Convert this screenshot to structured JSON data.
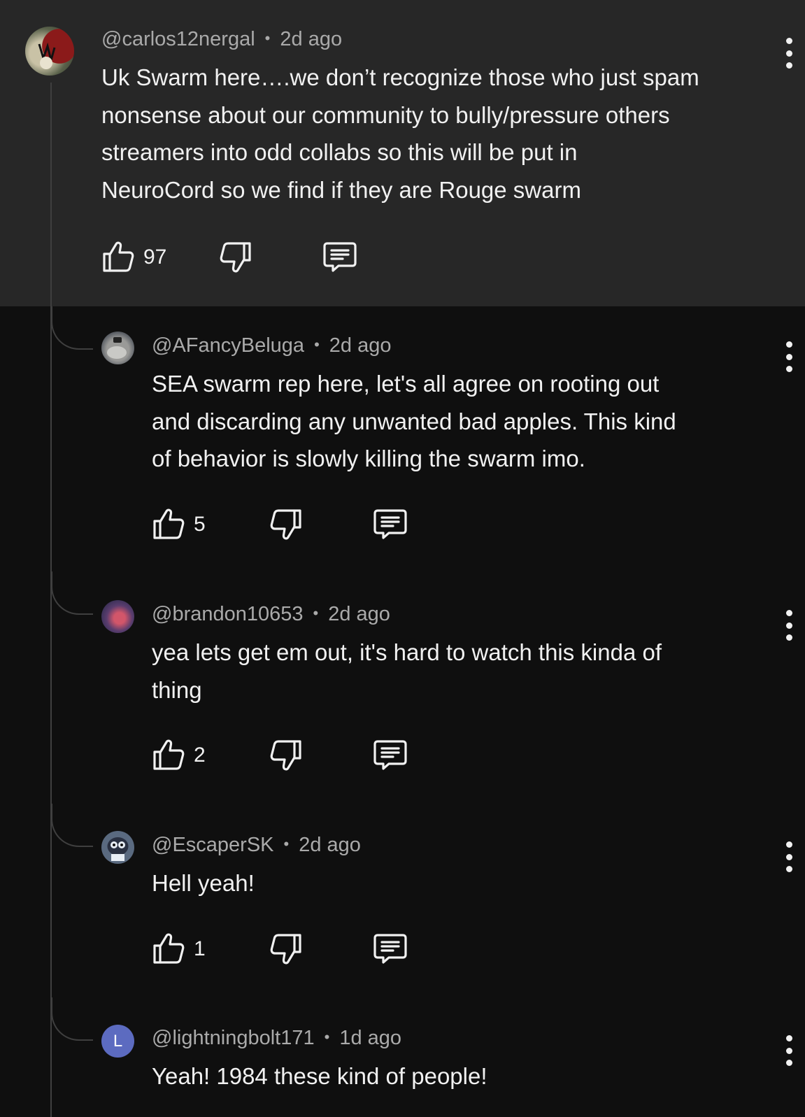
{
  "comments": [
    {
      "handle": "@carlos12nergal",
      "time": "2d ago",
      "text": "Uk Swarm here….we don’t recognize those who just spam\nnonsense about our community to bully/pressure others\nstreamers into odd collabs so this will be put in\nNeuroCord so we find if they are Rouge swarm",
      "likes": "97"
    }
  ],
  "replies": [
    {
      "handle": "@AFancyBeluga",
      "time": "2d ago",
      "text": "SEA swarm rep here, let's all agree on rooting out\nand discarding any unwanted bad apples. This kind\nof behavior is slowly killing the swarm imo.",
      "likes": "5"
    },
    {
      "handle": "@brandon10653",
      "time": "2d ago",
      "text": "yea lets get em out, it's hard to watch this kinda of\nthing",
      "likes": "2"
    },
    {
      "handle": "@EscaperSK",
      "time": "2d ago",
      "text": "Hell yeah!",
      "likes": "1"
    },
    {
      "handle": "@lightningbolt171",
      "time": "1d ago",
      "text": "Yeah! 1984 these kind of people!",
      "avatar_letter": "L"
    }
  ],
  "separator": "•",
  "colors": {
    "page_background": "#0f0f0f",
    "highlight_background": "#272727",
    "secondary_text": "#aaaaaa",
    "letter_avatar": "#5c6bc0"
  },
  "icons": [
    "thumb-up-icon",
    "thumb-down-icon",
    "reply-icon",
    "more-vert-icon"
  ]
}
